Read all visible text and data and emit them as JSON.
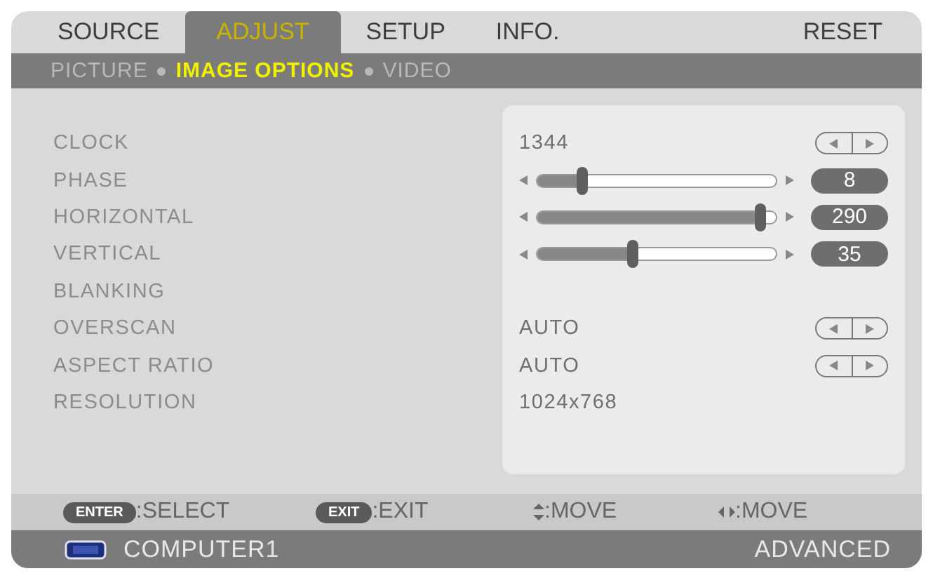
{
  "tabs": [
    {
      "label": "SOURCE",
      "selected": false
    },
    {
      "label": "ADJUST",
      "selected": true
    },
    {
      "label": "SETUP",
      "selected": false
    },
    {
      "label": "INFO.",
      "selected": false
    },
    {
      "label": "RESET",
      "selected": false
    }
  ],
  "subtabs": [
    {
      "label": "PICTURE",
      "selected": false
    },
    {
      "label": "IMAGE OPTIONS",
      "selected": true
    },
    {
      "label": "VIDEO",
      "selected": false
    }
  ],
  "rows": [
    {
      "kind": "arrows",
      "label": "CLOCK",
      "value": "1344"
    },
    {
      "kind": "slider",
      "label": "PHASE",
      "level": 0.19,
      "reading": "8"
    },
    {
      "kind": "slider",
      "label": "HORIZONTAL",
      "level": 0.93,
      "reading": "290"
    },
    {
      "kind": "slider",
      "label": "VERTICAL",
      "level": 0.4,
      "reading": "35"
    },
    {
      "kind": "label",
      "label": "BLANKING"
    },
    {
      "kind": "arrows",
      "label": "OVERSCAN",
      "value": "AUTO"
    },
    {
      "kind": "arrows",
      "label": "ASPECT RATIO",
      "value": "AUTO"
    },
    {
      "kind": "value",
      "label": "RESOLUTION",
      "value": "1024x768"
    }
  ],
  "hints": [
    {
      "kind": "key",
      "key": "ENTER",
      "text": ":SELECT"
    },
    {
      "kind": "key",
      "key": "EXIT",
      "text": ":EXIT"
    },
    {
      "kind": "updown",
      "text": ":MOVE"
    },
    {
      "kind": "leftright",
      "text": ":MOVE"
    }
  ],
  "status_bar": {
    "source": "COMPUTER1",
    "mode": "ADVANCED"
  }
}
